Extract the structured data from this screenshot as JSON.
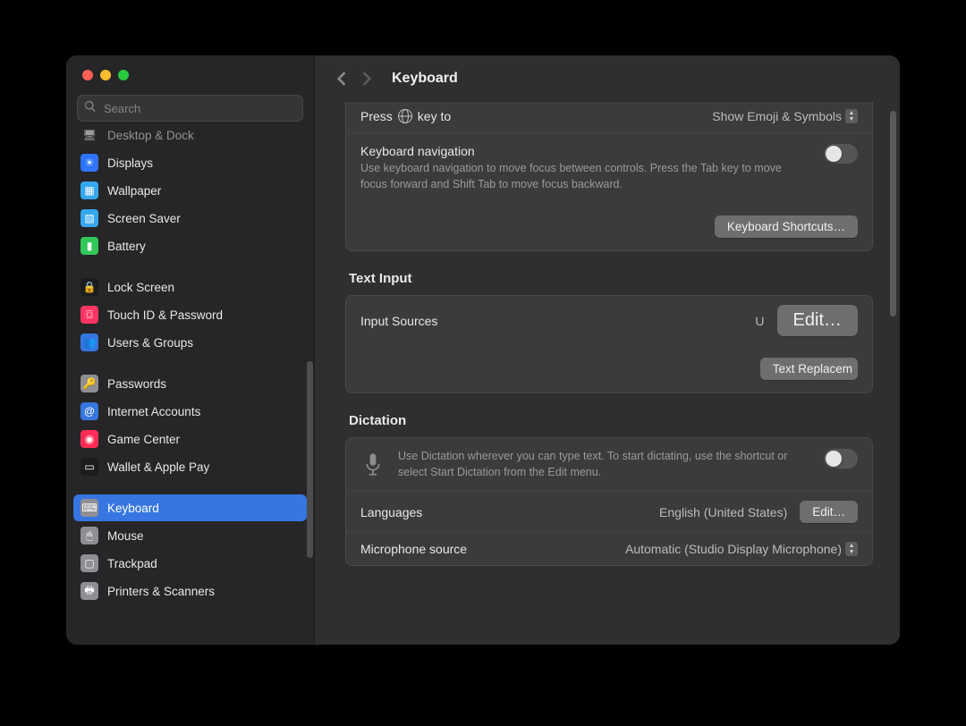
{
  "header": {
    "title": "Keyboard"
  },
  "search": {
    "placeholder": "Search"
  },
  "sidebar": {
    "items": [
      {
        "label": "Desktop & Dock",
        "icon_bg": "#2b2b2d",
        "icon_glyph": "🖥",
        "partial": true
      },
      {
        "label": "Displays",
        "icon_bg": "#2e74ff",
        "icon_glyph": "☀"
      },
      {
        "label": "Wallpaper",
        "icon_bg": "#35a7ee",
        "icon_glyph": "▦"
      },
      {
        "label": "Screen Saver",
        "icon_bg": "#35a7ee",
        "icon_glyph": "▧"
      },
      {
        "label": "Battery",
        "icon_bg": "#33c759",
        "icon_glyph": "▮"
      }
    ],
    "group2": [
      {
        "label": "Lock Screen",
        "icon_bg": "#1c1c1e",
        "icon_glyph": "🔒"
      },
      {
        "label": "Touch ID & Password",
        "icon_bg": "#ff3664",
        "icon_glyph": "⌼"
      },
      {
        "label": "Users & Groups",
        "icon_bg": "#3776e0",
        "icon_glyph": "👥"
      }
    ],
    "group3": [
      {
        "label": "Passwords",
        "icon_bg": "#8e8e93",
        "icon_glyph": "🔑"
      },
      {
        "label": "Internet Accounts",
        "icon_bg": "#3776e0",
        "icon_glyph": "@"
      },
      {
        "label": "Game Center",
        "icon_bg": "#ff2d55",
        "icon_glyph": "◉"
      },
      {
        "label": "Wallet & Apple Pay",
        "icon_bg": "#1c1c1e",
        "icon_glyph": "▭"
      }
    ],
    "group4": [
      {
        "label": "Keyboard",
        "icon_bg": "#8e8e93",
        "icon_glyph": "⌨",
        "selected": true
      },
      {
        "label": "Mouse",
        "icon_bg": "#8e8e93",
        "icon_glyph": "🖱"
      },
      {
        "label": "Trackpad",
        "icon_bg": "#8e8e93",
        "icon_glyph": "▢"
      },
      {
        "label": "Printers & Scanners",
        "icon_bg": "#8e8e93",
        "icon_glyph": "🖶"
      }
    ]
  },
  "main": {
    "press_key": {
      "label_prefix": "Press",
      "label_suffix": "key to",
      "value": "Show Emoji & Symbols"
    },
    "nav": {
      "label": "Keyboard navigation",
      "desc": "Use keyboard navigation to move focus between controls. Press the Tab key to move focus forward and Shift Tab to move focus backward.",
      "enabled": false
    },
    "shortcuts_btn": "Keyboard Shortcuts…",
    "text_input": {
      "title": "Text Input",
      "input_sources_label": "Input Sources",
      "input_sources_value": "U",
      "edit_btn": "Edit…",
      "text_replace_btn": "Text Replacem"
    },
    "dictation": {
      "title": "Dictation",
      "desc": "Use Dictation wherever you can type text. To start dictating, use the shortcut or select Start Dictation from the Edit menu.",
      "enabled": false,
      "languages_label": "Languages",
      "languages_value": "English (United States)",
      "languages_edit_btn": "Edit…",
      "mic_label": "Microphone source",
      "mic_value": "Automatic (Studio Display Microphone)"
    }
  },
  "annotation": {
    "shape": "circle",
    "color": "#e04a2a"
  }
}
